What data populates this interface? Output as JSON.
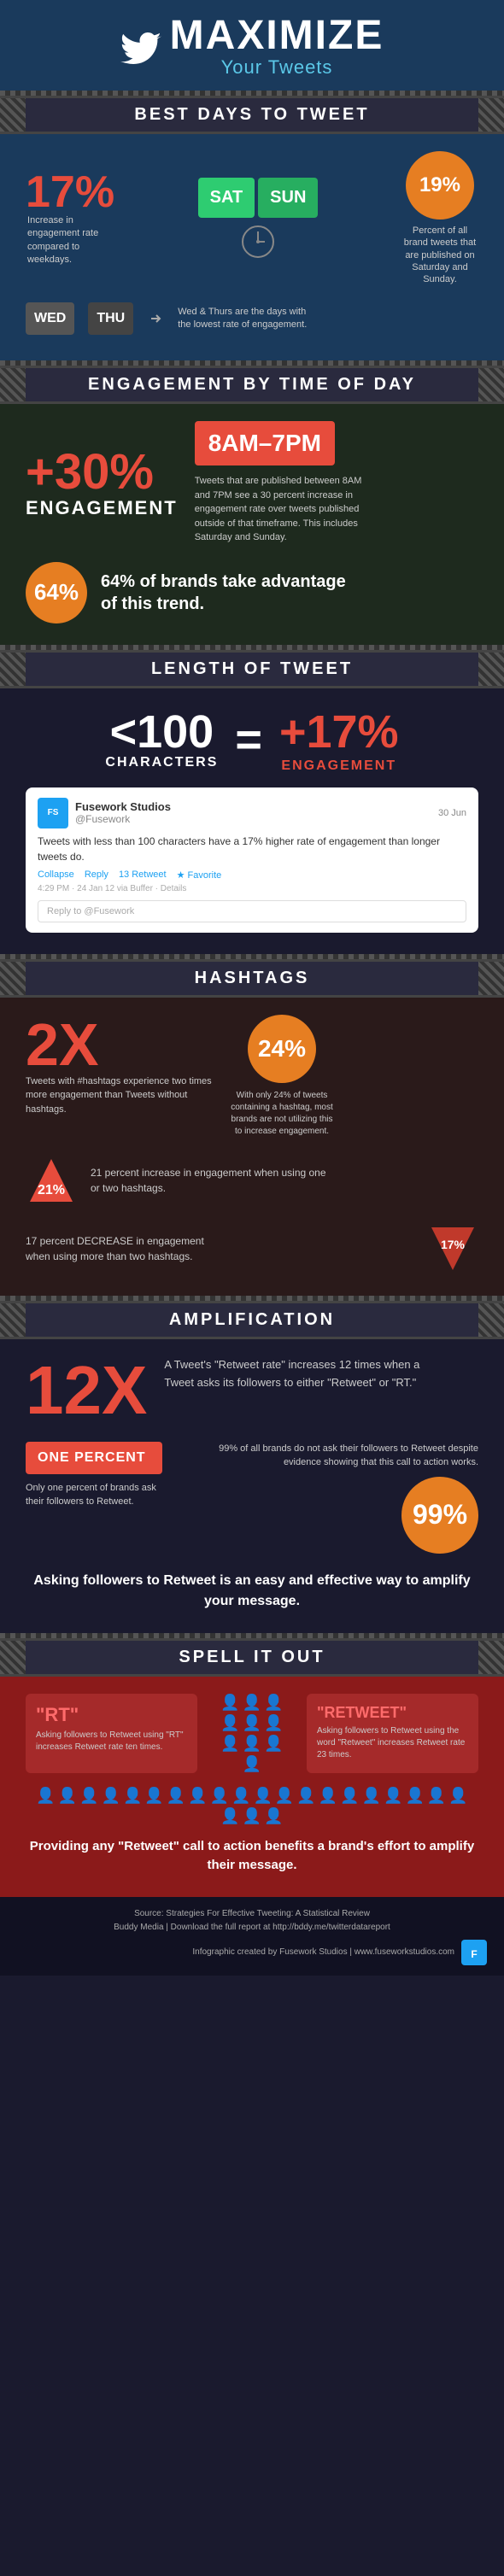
{
  "header": {
    "title": "MAXIMIZE",
    "subtitle": "Your Tweets"
  },
  "sections": {
    "best_days": {
      "banner": "BEST DAYS TO TWEET",
      "stat17": "17%",
      "stat17_desc": "Increase in engagement rate compared to weekdays.",
      "days_high": [
        "SAT",
        "SUN"
      ],
      "stat19": "19%",
      "stat19_desc": "Percent of all brand tweets that are published on Saturday and Sunday.",
      "days_low": [
        "WED",
        "THU"
      ],
      "wed_thu_desc": "Wed & Thurs are the days with the lowest rate of engagement."
    },
    "engagement_time": {
      "banner": "ENGAGEMENT BY TIME OF DAY",
      "stat30": "+30%",
      "label": "ENGAGEMENT",
      "time_range": "8AM–7PM",
      "desc": "Tweets that are published between 8AM and 7PM see a 30 percent increase in engagement rate over tweets published outside of that timeframe. This includes Saturday and Sunday.",
      "stat64": "64%",
      "stat64_text": "64% of brands take advantage of this trend."
    },
    "length": {
      "banner": "LENGTH OF TWEET",
      "chars": "<100",
      "chars_label": "CHARACTERS",
      "equals": "=",
      "plus17": "+17%",
      "eng_label": "ENGAGEMENT",
      "tweet": {
        "user": "Fusework Studios",
        "handle": "@Fusework",
        "date": "30 Jun",
        "body": "Tweets with less than 100 characters have a 17% higher rate of engagement than longer tweets do.",
        "actions": [
          "Collapse",
          "Reply",
          "13 Retweet",
          "Favorite"
        ],
        "meta": "4:29 PM · 24 Jan 12 via Buffer · Details",
        "reply_placeholder": "Reply to @Fusework"
      }
    },
    "hashtags": {
      "banner": "HASHTAGS",
      "stat2x": "2X",
      "desc_2x": "Tweets with #hashtags experience two times more engagement than Tweets without hashtags.",
      "stat24": "24%",
      "desc_24": "With only 24% of tweets containing a hashtag, most brands are not utilizing this to increase engagement.",
      "stat21": "21%",
      "desc_21": "21 percent increase in engagement when using one or two hashtags.",
      "stat17": "17%",
      "desc_17": "17 percent DECREASE in engagement when using more than two hashtags."
    },
    "amplification": {
      "banner": "AMPLIFICATION",
      "stat12x": "12X",
      "desc_12x": "A Tweet's \"Retweet rate\" increases 12 times when a Tweet asks its followers to either \"Retweet\" or \"RT.\"",
      "one_pct_label": "ONE PERCENT",
      "one_pct_desc": "Only one percent of brands ask their followers to Retweet.",
      "stat99": "99%",
      "desc_99": "99% of all brands do not ask their followers to Retweet despite evidence showing that this call to action works.",
      "cta": "Asking followers to Retweet is an easy and effective way to amplify your message."
    },
    "spell_it_out": {
      "banner": "SPELL IT OUT",
      "rt_label": "\"RT\"",
      "rt_desc": "Asking followers to Retweet using \"RT\" increases Retweet rate ten times.",
      "retweet_label": "\"RETWEET\"",
      "retweet_desc": "Asking followers to Retweet using the word \"Retweet\" increases Retweet rate 23 times.",
      "cta": "Providing any \"Retweet\" call to action benefits a brand's effort to amplify their message."
    }
  },
  "footer": {
    "source": "Source: Strategies For Effective Tweeting: A Statistical Review",
    "buddy": "Buddy Media | Download the full report at http://bddy.me/twitterdatareport",
    "credit": "Infographic created by Fusework Studios | www.fuseworkstudios.com"
  }
}
